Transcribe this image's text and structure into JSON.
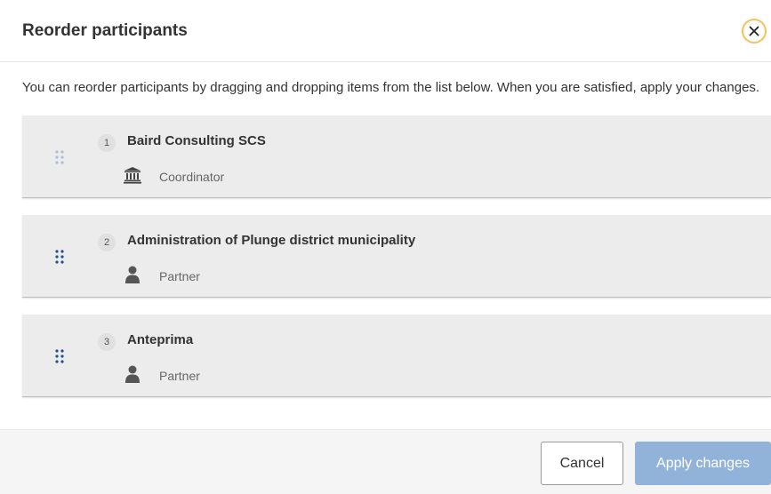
{
  "dialog": {
    "title": "Reorder participants",
    "intro": "You can reorder participants by dragging and dropping items from the list below. When you are satisfied, apply your changes."
  },
  "participants": [
    {
      "number": "1",
      "name": "Baird Consulting SCS",
      "role": "Coordinator",
      "role_icon": "institution-icon",
      "handle_color": "#a8bfdc"
    },
    {
      "number": "2",
      "name": "Administration of Plunge district municipality",
      "role": "Partner",
      "role_icon": "user-icon",
      "handle_color": "#1f4f8f"
    },
    {
      "number": "3",
      "name": "Anteprima",
      "role": "Partner",
      "role_icon": "user-icon",
      "handle_color": "#1f4f8f"
    }
  ],
  "footer": {
    "cancel_label": "Cancel",
    "apply_label": "Apply changes"
  },
  "colors": {
    "accent_close_ring": "#f3c35a",
    "apply_button": "#92b3d9",
    "card_background": "#ececec"
  }
}
